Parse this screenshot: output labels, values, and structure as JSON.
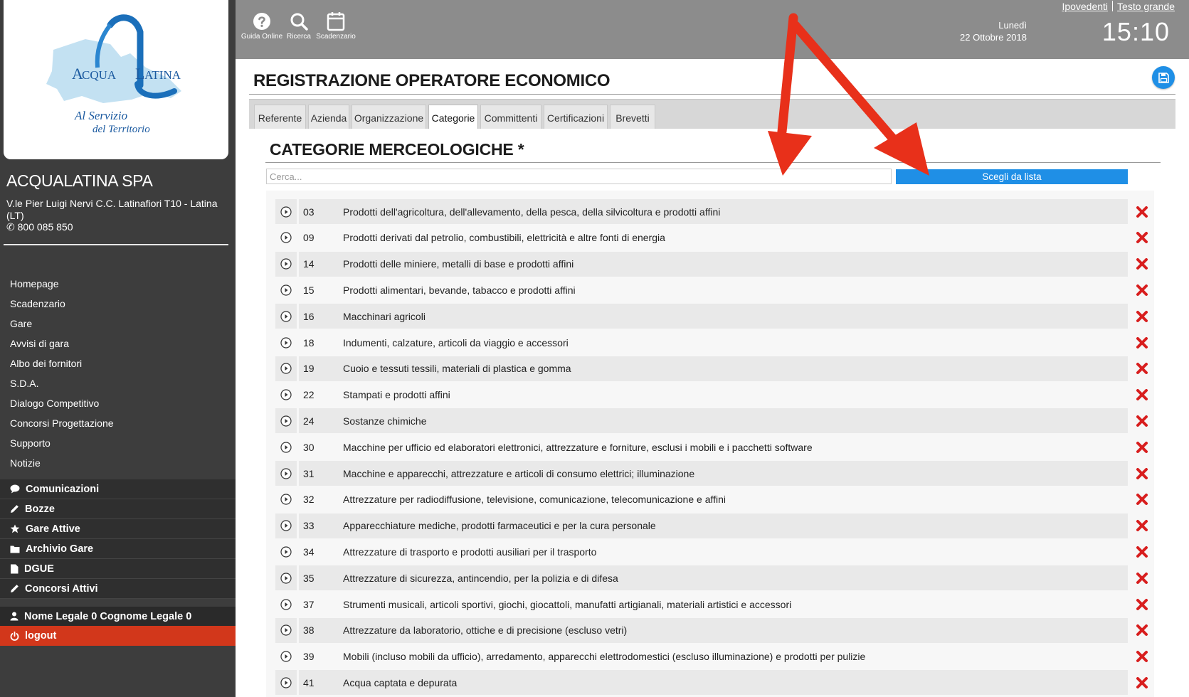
{
  "sidebar": {
    "logo": {
      "name": "ACQUALATINA",
      "tagline": "Al Servizio del Territorio"
    },
    "org_name": "ACQUALATINA SPA",
    "address": "V.le Pier Luigi Nervi C.C. Latinafiori T10 - Latina (LT)",
    "phone": "800 085 850",
    "nav": [
      {
        "label": "Homepage"
      },
      {
        "label": "Scadenzario"
      },
      {
        "label": "Gare"
      },
      {
        "label": "Avvisi di gara"
      },
      {
        "label": "Albo dei fornitori"
      },
      {
        "label": "S.D.A."
      },
      {
        "label": "Dialogo Competitivo"
      },
      {
        "label": "Concorsi Progettazione"
      },
      {
        "label": "Supporto"
      },
      {
        "label": "Notizie"
      }
    ],
    "dark_menu": [
      {
        "label": "Comunicazioni",
        "icon": "comment-icon"
      },
      {
        "label": "Bozze",
        "icon": "pencil-icon"
      },
      {
        "label": "Gare Attive",
        "icon": "star-icon"
      },
      {
        "label": "Archivio Gare",
        "icon": "folder-icon"
      },
      {
        "label": "DGUE",
        "icon": "file-icon"
      },
      {
        "label": "Concorsi Attivi",
        "icon": "pencil-icon"
      }
    ],
    "user_name": "Nome Legale 0 Cognome Legale 0",
    "logout_label": "logout"
  },
  "header": {
    "toolbar": [
      {
        "label": "Guida Online",
        "icon": "help-icon"
      },
      {
        "label": "Ricerca",
        "icon": "search-icon"
      },
      {
        "label": "Scadenzario",
        "icon": "calendar-icon"
      }
    ],
    "accessibility": {
      "low_vision": "Ipovedenti",
      "large_text": "Testo grande"
    },
    "day": "Lunedì",
    "date": "22 Ottobre 2018",
    "time": "15:10"
  },
  "page": {
    "title": "REGISTRAZIONE OPERATORE ECONOMICO",
    "tabs": [
      {
        "label": "Referente",
        "active": false
      },
      {
        "label": "Azienda",
        "active": false
      },
      {
        "label": "Organizzazione",
        "active": false
      },
      {
        "label": "Categorie",
        "active": true
      },
      {
        "label": "Committenti",
        "active": false
      },
      {
        "label": "Certificazioni",
        "active": false
      },
      {
        "label": "Brevetti",
        "active": false
      }
    ],
    "section_title": "CATEGORIE MERCEOLOGICHE *",
    "search": {
      "placeholder": "Cerca...",
      "value": ""
    },
    "choose_button": "Scegli da lista",
    "categories": [
      {
        "code": "03",
        "description": "Prodotti dell'agricoltura, dell'allevamento, della pesca, della silvicoltura e prodotti affini"
      },
      {
        "code": "09",
        "description": "Prodotti derivati dal petrolio, combustibili, elettricità e altre fonti di energia"
      },
      {
        "code": "14",
        "description": "Prodotti delle miniere, metalli di base e prodotti affini"
      },
      {
        "code": "15",
        "description": "Prodotti alimentari, bevande, tabacco e prodotti affini"
      },
      {
        "code": "16",
        "description": "Macchinari agricoli"
      },
      {
        "code": "18",
        "description": "Indumenti, calzature, articoli da viaggio e accessori"
      },
      {
        "code": "19",
        "description": "Cuoio e tessuti tessili, materiali di plastica e gomma"
      },
      {
        "code": "22",
        "description": "Stampati e prodotti affini"
      },
      {
        "code": "24",
        "description": "Sostanze chimiche"
      },
      {
        "code": "30",
        "description": "Macchine per ufficio ed elaboratori elettronici, attrezzature e forniture, esclusi i mobili e i pacchetti software"
      },
      {
        "code": "31",
        "description": "Macchine e apparecchi, attrezzature e articoli di consumo elettrici; illuminazione"
      },
      {
        "code": "32",
        "description": "Attrezzature per radiodiffusione, televisione, comunicazione, telecomunicazione e affini"
      },
      {
        "code": "33",
        "description": "Apparecchiature mediche, prodotti farmaceutici e per la cura personale"
      },
      {
        "code": "34",
        "description": "Attrezzature di trasporto e prodotti ausiliari per il trasporto"
      },
      {
        "code": "35",
        "description": "Attrezzature di sicurezza, antincendio, per la polizia e di difesa"
      },
      {
        "code": "37",
        "description": "Strumenti musicali, articoli sportivi, giochi, giocattoli, manufatti artigianali, materiali artistici e accessori"
      },
      {
        "code": "38",
        "description": "Attrezzature da laboratorio, ottiche e di precisione (escluso vetri)"
      },
      {
        "code": "39",
        "description": "Mobili (incluso mobili da ufficio), arredamento, apparecchi elettrodomestici (escluso illuminazione) e prodotti per pulizie"
      },
      {
        "code": "41",
        "description": "Acqua captata e depurata"
      }
    ]
  },
  "colors": {
    "accent": "#1f8fe6",
    "sidebar": "#3d3d3d",
    "topbar": "#8c8c8c",
    "logout": "#d2371b",
    "delete": "#d81e1e",
    "annotation_arrow": "#e8301a"
  }
}
